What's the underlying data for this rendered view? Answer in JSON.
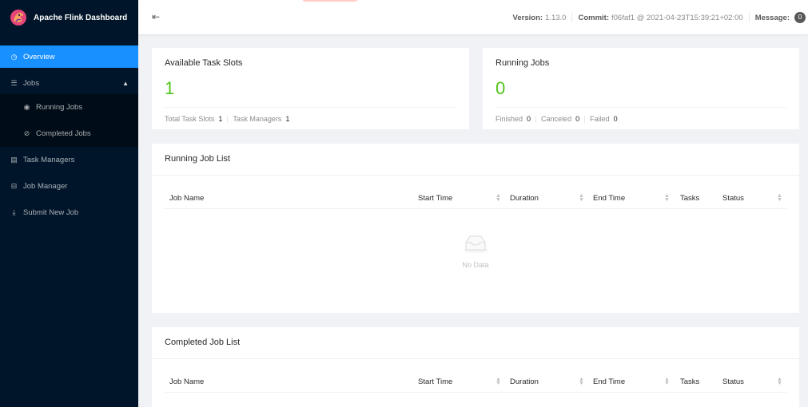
{
  "sidebar": {
    "brand": "Apache Flink Dashboard",
    "items": [
      {
        "label": "Overview",
        "icon": "dashboard-icon"
      },
      {
        "label": "Jobs",
        "icon": "list-icon"
      },
      {
        "label": "Running Jobs",
        "icon": "play-circle-icon"
      },
      {
        "label": "Completed Jobs",
        "icon": "check-circle-icon"
      },
      {
        "label": "Task Managers",
        "icon": "task-managers-icon"
      },
      {
        "label": "Job Manager",
        "icon": "cluster-icon"
      },
      {
        "label": "Submit New Job",
        "icon": "upload-icon"
      }
    ]
  },
  "header": {
    "version_label": "Version:",
    "version": "1.13.0",
    "commit_label": "Commit:",
    "commit": "f06faf1 @ 2021-04-23T15:39:21+02:00",
    "message_label": "Message:",
    "message_count": "0"
  },
  "slots_card": {
    "title": "Available Task Slots",
    "value": "1",
    "total_label": "Total Task Slots",
    "total": "1",
    "tm_label": "Task Managers",
    "tm": "1"
  },
  "jobs_card": {
    "title": "Running Jobs",
    "value": "0",
    "finished_label": "Finished",
    "finished": "0",
    "canceled_label": "Canceled",
    "canceled": "0",
    "failed_label": "Failed",
    "failed": "0"
  },
  "running_list": {
    "title": "Running Job List",
    "columns": [
      "Job Name",
      "Start Time",
      "Duration",
      "End Time",
      "Tasks",
      "Status"
    ],
    "empty_text": "No Data"
  },
  "completed_list": {
    "title": "Completed Job List",
    "columns": [
      "Job Name",
      "Start Time",
      "Duration",
      "End Time",
      "Tasks",
      "Status"
    ]
  },
  "colors": {
    "sidebar_bg": "#001529",
    "active": "#1890ff",
    "value_green": "#52c41a"
  }
}
